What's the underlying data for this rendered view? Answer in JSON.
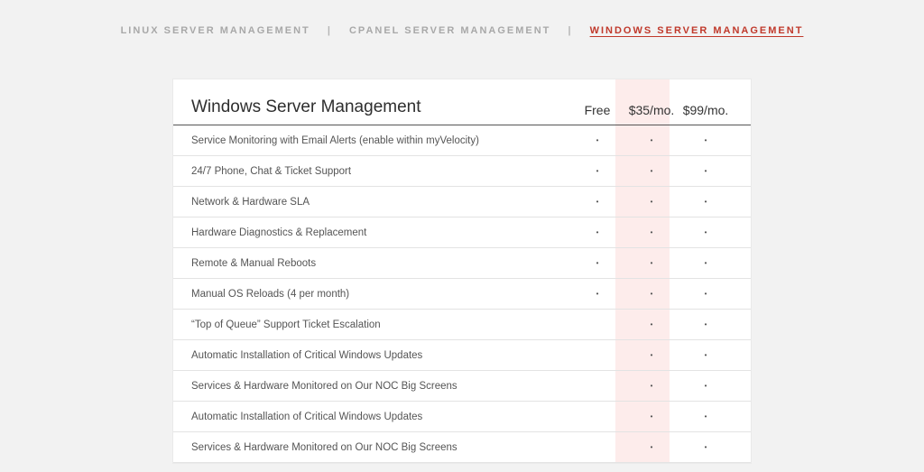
{
  "tabs": {
    "linux": "LINUX SERVER MANAGEMENT",
    "cpanel": "CPANEL SERVER MANAGEMENT",
    "windows": "WINDOWS SERVER MANAGEMENT",
    "active": "windows",
    "sep": "|"
  },
  "table": {
    "title": "Windows Server Management",
    "cols": {
      "c1": "Free",
      "c2": "$35/mo.",
      "c3": "$99/mo."
    },
    "dot": "•",
    "rows": [
      {
        "label": "Service Monitoring with Email Alerts (enable within myVelocity)",
        "c1": true,
        "c2": true,
        "c3": true
      },
      {
        "label": "24/7 Phone, Chat & Ticket Support",
        "c1": true,
        "c2": true,
        "c3": true
      },
      {
        "label": "Network & Hardware SLA",
        "c1": true,
        "c2": true,
        "c3": true
      },
      {
        "label": "Hardware Diagnostics & Replacement",
        "c1": true,
        "c2": true,
        "c3": true
      },
      {
        "label": "Remote & Manual Reboots",
        "c1": true,
        "c2": true,
        "c3": true
      },
      {
        "label": "Manual OS Reloads (4 per month)",
        "c1": true,
        "c2": true,
        "c3": true
      },
      {
        "label": "“Top of Queue” Support Ticket Escalation",
        "c1": false,
        "c2": true,
        "c3": true
      },
      {
        "label": "Automatic Installation of Critical Windows Updates",
        "c1": false,
        "c2": true,
        "c3": true
      },
      {
        "label": "Services & Hardware Monitored on Our NOC Big Screens",
        "c1": false,
        "c2": true,
        "c3": true
      },
      {
        "label": "Automatic Installation of Critical Windows Updates",
        "c1": false,
        "c2": true,
        "c3": true
      },
      {
        "label": "Services & Hardware Monitored on Our NOC Big Screens",
        "c1": false,
        "c2": true,
        "c3": true
      }
    ]
  }
}
